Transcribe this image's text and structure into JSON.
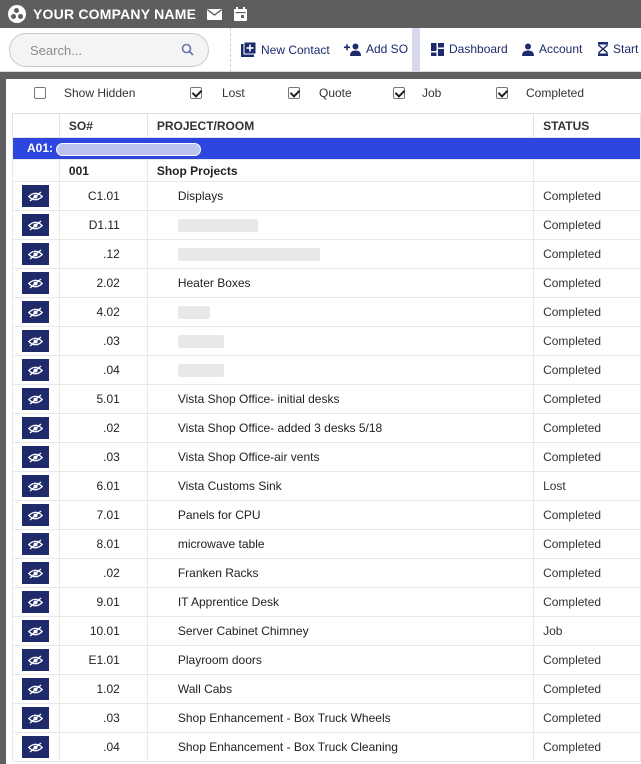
{
  "header": {
    "company": "YOUR COMPANY NAME"
  },
  "search": {
    "placeholder": "Search..."
  },
  "toolbar": {
    "new_contact": "New Contact",
    "add_so": "Add SO",
    "dashboard": "Dashboard",
    "account": "Account",
    "start": "Start"
  },
  "filters": {
    "show_hidden": "Show Hidden",
    "lost": "Lost",
    "quote": "Quote",
    "job": "Job",
    "completed": "Completed"
  },
  "table": {
    "headers": {
      "so": "SO#",
      "project": "PROJECT/ROOM",
      "status": "STATUS"
    },
    "group_label": "A01:",
    "sub_so": "001",
    "sub_project": "Shop Projects",
    "rows": [
      {
        "so": "C1.01",
        "project": "Displays",
        "status": "Completed"
      },
      {
        "so": "D1.11",
        "project": "",
        "status": "Completed"
      },
      {
        "so": ".12",
        "project": "",
        "status": "Completed"
      },
      {
        "so": "2.02",
        "project": "Heater Boxes",
        "status": "Completed"
      },
      {
        "so": "4.02",
        "project": "",
        "status": "Completed"
      },
      {
        "so": ".03",
        "project": "",
        "status": "Completed"
      },
      {
        "so": ".04",
        "project": "",
        "status": "Completed"
      },
      {
        "so": "5.01",
        "project": "Vista Shop Office- initial desks",
        "status": "Completed"
      },
      {
        "so": ".02",
        "project": "Vista Shop Office- added 3 desks 5/18",
        "status": "Completed"
      },
      {
        "so": ".03",
        "project": "Vista Shop Office-air vents",
        "status": "Completed"
      },
      {
        "so": "6.01",
        "project": "Vista Customs Sink",
        "status": "Lost"
      },
      {
        "so": "7.01",
        "project": "Panels for CPU",
        "status": "Completed"
      },
      {
        "so": "8.01",
        "project": "microwave table",
        "status": "Completed"
      },
      {
        "so": ".02",
        "project": "Franken Racks",
        "status": "Completed"
      },
      {
        "so": "9.01",
        "project": "IT Apprentice Desk",
        "status": "Completed"
      },
      {
        "so": "10.01",
        "project": "Server Cabinet Chimney",
        "status": "Job"
      },
      {
        "so": "E1.01",
        "project": "Playroom doors",
        "status": "Completed"
      },
      {
        "so": "1.02",
        "project": "Wall Cabs",
        "status": "Completed"
      },
      {
        "so": ".03",
        "project": "Shop Enhancement - Box Truck Wheels",
        "status": "Completed"
      },
      {
        "so": ".04",
        "project": "Shop Enhancement - Box Truck Cleaning",
        "status": "Completed"
      }
    ]
  }
}
